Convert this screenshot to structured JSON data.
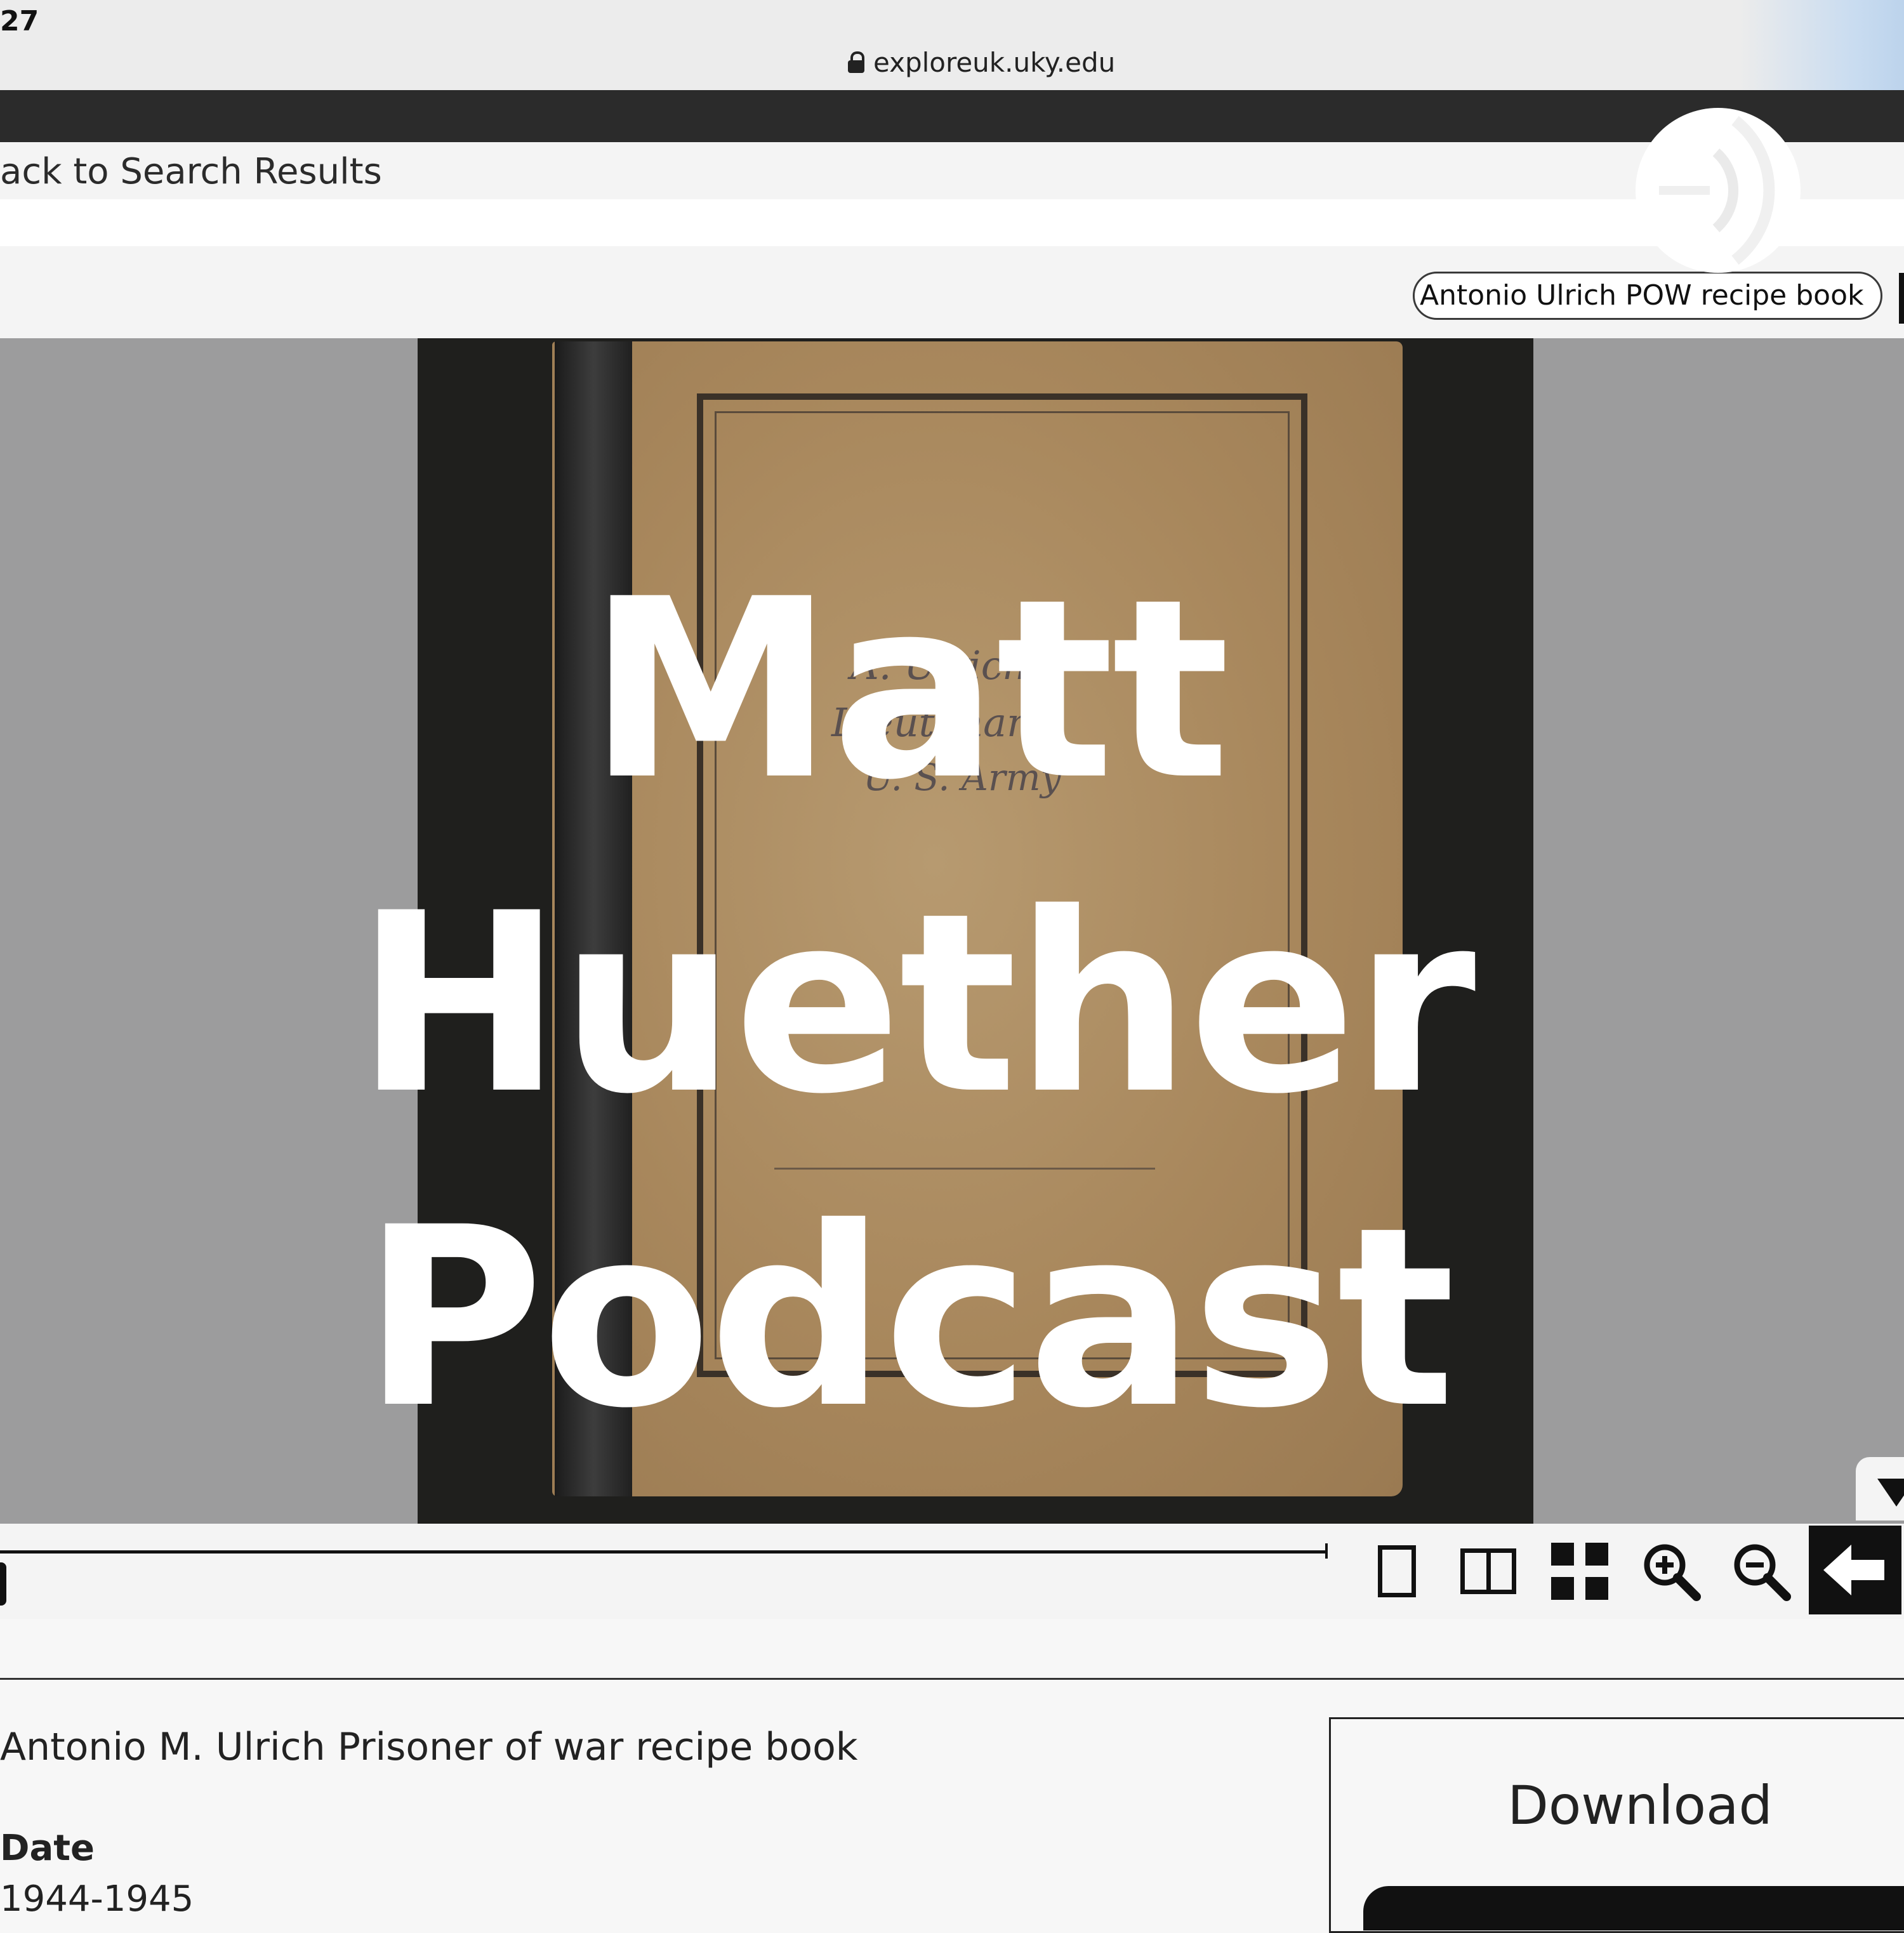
{
  "status_bar": {
    "time": "27"
  },
  "browser": {
    "url": "exploreuk.uky.edu",
    "lock_icon": "lock-icon"
  },
  "header": {
    "back_link": "ack to Search Results"
  },
  "search": {
    "value": "Antonio Ulrich POW recipe book"
  },
  "viewer": {
    "overlay_title": [
      "Matt",
      "Huether",
      "Podcast"
    ],
    "handwriting": [
      "A. Ulrich",
      "Lieutenant",
      "U. S. Army"
    ],
    "podcast_logo_icon": "podcast-broadcast-icon",
    "toggle_icon": "triangle-down-icon"
  },
  "toolbar": {
    "tools": [
      {
        "icon": "single-page-icon"
      },
      {
        "icon": "two-page-icon"
      },
      {
        "icon": "thumbnail-grid-icon"
      },
      {
        "icon": "zoom-in-icon"
      },
      {
        "icon": "zoom-out-icon"
      },
      {
        "icon": "arrow-left-icon"
      }
    ]
  },
  "metadata": {
    "title": "Antonio M. Ulrich Prisoner of war recipe book",
    "date_label": "Date",
    "date_value": "1944-1945"
  },
  "download": {
    "heading": "Download"
  },
  "colors": {
    "viewer_bg": "#9c9c9d",
    "toolbar_bg": "#f4f4f4",
    "dark_bar": "#2b2b2b",
    "overlay_text": "#ffffff"
  }
}
